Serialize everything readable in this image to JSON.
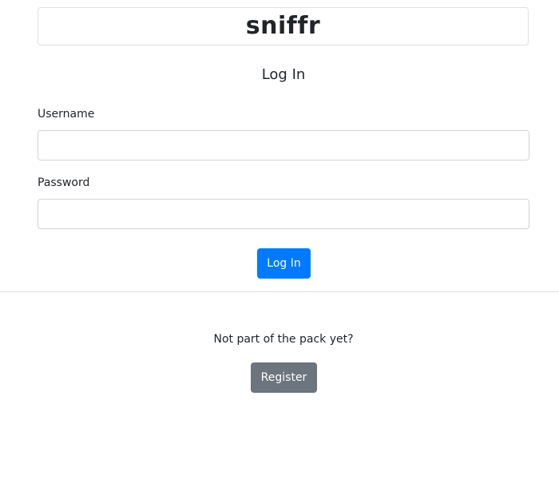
{
  "brand": {
    "logo_text": "sniffr"
  },
  "login_form": {
    "title": "Log In",
    "username_label": "Username",
    "username_value": "",
    "password_label": "Password",
    "password_value": "",
    "submit_label": "Log In"
  },
  "register_section": {
    "prompt": "Not part of the pack yet?",
    "button_label": "Register"
  },
  "colors": {
    "primary": "#007bff",
    "secondary": "#6c757d",
    "border": "#dee2e6",
    "text": "#212529"
  }
}
